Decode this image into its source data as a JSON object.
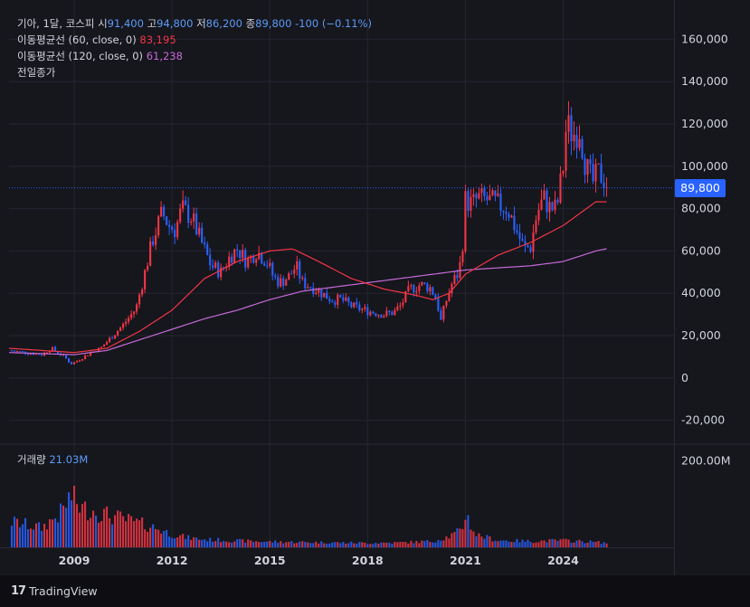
{
  "legend": {
    "symbol": "기아, 1달, 코스피",
    "open_label": "시",
    "open": "91,400",
    "high_label": "고",
    "high": "94,800",
    "low_label": "저",
    "low": "86,200",
    "close_label": "종",
    "close": "89,800",
    "change": "-100 (−0.11%)",
    "ma60_label": "이동평균선 (60, close, 0)",
    "ma60_value": "83,195",
    "ma120_label": "이동평균선 (120, close, 0)",
    "ma120_value": "61,238",
    "prev_close_label": "전일종가"
  },
  "volume_legend": {
    "label": "거래량",
    "value": "21.03M"
  },
  "price_badge": "89,800",
  "logo_text": "TradingView",
  "colors": {
    "up": "#f23645",
    "down": "#2962ff",
    "ma60": "#f23645",
    "ma120": "#c56ad6",
    "grid": "#252530",
    "axis_text": "#d1d4dc"
  },
  "chart_data": {
    "type": "candlestick",
    "interval": "1 month",
    "price_axis": {
      "ticks": [
        160000,
        140000,
        120000,
        100000,
        80000,
        60000,
        40000,
        20000,
        0,
        -20000
      ],
      "tick_labels": [
        "160,000",
        "140,000",
        "120,000",
        "100,000",
        "80,000",
        "60,000",
        "40,000",
        "20,000",
        "0",
        "-20,000"
      ],
      "range": [
        -30000,
        170000
      ]
    },
    "volume_axis": {
      "ticks": [
        200000000
      ],
      "tick_labels": [
        "200.00M"
      ]
    },
    "x_axis": {
      "tick_labels": [
        "2009",
        "2012",
        "2015",
        "2018",
        "2021",
        "2024"
      ],
      "tick_years": [
        2009,
        2012,
        2015,
        2018,
        2021,
        2024
      ]
    },
    "last_close": 89800,
    "price_path": [
      [
        2007.0,
        13000
      ],
      [
        2007.5,
        12000
      ],
      [
        2008.0,
        11000
      ],
      [
        2008.3,
        14000
      ],
      [
        2008.7,
        10000
      ],
      [
        2008.9,
        6500
      ],
      [
        2009.2,
        9000
      ],
      [
        2009.5,
        12000
      ],
      [
        2009.8,
        14000
      ],
      [
        2010.0,
        17000
      ],
      [
        2010.5,
        25000
      ],
      [
        2010.9,
        33000
      ],
      [
        2011.2,
        52000
      ],
      [
        2011.4,
        65000
      ],
      [
        2011.7,
        78000
      ],
      [
        2011.9,
        72000
      ],
      [
        2012.1,
        70000
      ],
      [
        2012.3,
        80000
      ],
      [
        2012.6,
        76000
      ],
      [
        2012.9,
        64000
      ],
      [
        2013.2,
        53000
      ],
      [
        2013.5,
        50000
      ],
      [
        2013.8,
        58000
      ],
      [
        2014.0,
        61000
      ],
      [
        2014.3,
        55000
      ],
      [
        2014.6,
        60000
      ],
      [
        2014.9,
        55000
      ],
      [
        2015.1,
        48000
      ],
      [
        2015.3,
        45000
      ],
      [
        2015.6,
        48000
      ],
      [
        2015.8,
        53000
      ],
      [
        2016.0,
        45000
      ],
      [
        2016.3,
        43000
      ],
      [
        2016.6,
        40000
      ],
      [
        2016.9,
        37000
      ],
      [
        2017.2,
        37000
      ],
      [
        2017.5,
        34000
      ],
      [
        2017.9,
        32000
      ],
      [
        2018.2,
        31000
      ],
      [
        2018.5,
        30000
      ],
      [
        2018.8,
        31000
      ],
      [
        2019.0,
        34000
      ],
      [
        2019.3,
        42000
      ],
      [
        2019.6,
        44000
      ],
      [
        2019.9,
        43000
      ],
      [
        2020.1,
        38000
      ],
      [
        2020.25,
        27000
      ],
      [
        2020.4,
        36000
      ],
      [
        2020.6,
        45000
      ],
      [
        2020.8,
        50000
      ],
      [
        2020.9,
        60000
      ],
      [
        2021.0,
        84000
      ],
      [
        2021.2,
        82000
      ],
      [
        2021.4,
        85000
      ],
      [
        2021.7,
        84000
      ],
      [
        2022.0,
        82000
      ],
      [
        2022.3,
        80000
      ],
      [
        2022.5,
        72000
      ],
      [
        2022.8,
        61000
      ],
      [
        2023.0,
        62000
      ],
      [
        2023.2,
        78000
      ],
      [
        2023.4,
        85000
      ],
      [
        2023.6,
        80000
      ],
      [
        2023.8,
        80000
      ],
      [
        2024.0,
        100000
      ],
      [
        2024.1,
        120000
      ],
      [
        2024.3,
        115000
      ],
      [
        2024.5,
        118000
      ],
      [
        2024.7,
        100000
      ],
      [
        2024.9,
        92000
      ],
      [
        2025.1,
        97000
      ],
      [
        2025.3,
        93000
      ],
      [
        2025.4,
        89800
      ]
    ],
    "ma60_path": [
      [
        2007.0,
        14000
      ],
      [
        2009.0,
        12000
      ],
      [
        2010.0,
        14000
      ],
      [
        2011.0,
        22000
      ],
      [
        2012.0,
        32000
      ],
      [
        2013.0,
        47000
      ],
      [
        2014.0,
        55000
      ],
      [
        2015.0,
        60000
      ],
      [
        2015.7,
        61000
      ],
      [
        2016.5,
        55000
      ],
      [
        2017.5,
        47000
      ],
      [
        2018.5,
        42000
      ],
      [
        2019.5,
        39000
      ],
      [
        2020.0,
        37000
      ],
      [
        2020.5,
        40000
      ],
      [
        2021.0,
        49000
      ],
      [
        2022.0,
        58000
      ],
      [
        2023.0,
        64000
      ],
      [
        2024.0,
        72000
      ],
      [
        2025.0,
        83195
      ],
      [
        2025.4,
        83195
      ]
    ],
    "ma120_path": [
      [
        2007.0,
        12000
      ],
      [
        2009.0,
        11000
      ],
      [
        2010.0,
        13000
      ],
      [
        2011.0,
        18000
      ],
      [
        2012.0,
        23000
      ],
      [
        2013.0,
        28000
      ],
      [
        2014.0,
        32000
      ],
      [
        2015.0,
        37000
      ],
      [
        2016.0,
        41000
      ],
      [
        2017.0,
        43000
      ],
      [
        2018.0,
        45000
      ],
      [
        2019.0,
        47000
      ],
      [
        2020.0,
        49000
      ],
      [
        2021.0,
        51000
      ],
      [
        2022.0,
        52000
      ],
      [
        2023.0,
        53000
      ],
      [
        2024.0,
        55000
      ],
      [
        2025.0,
        60000
      ],
      [
        2025.4,
        61238
      ]
    ],
    "volume_path": [
      [
        2007.0,
        60
      ],
      [
        2008.0,
        45
      ],
      [
        2008.6,
        80
      ],
      [
        2008.9,
        120
      ],
      [
        2009.2,
        90
      ],
      [
        2009.6,
        85
      ],
      [
        2010.0,
        75
      ],
      [
        2010.5,
        65
      ],
      [
        2011.0,
        55
      ],
      [
        2011.5,
        45
      ],
      [
        2012.0,
        30
      ],
      [
        2012.5,
        22
      ],
      [
        2013.0,
        18
      ],
      [
        2014.0,
        15
      ],
      [
        2015.0,
        13
      ],
      [
        2016.0,
        12
      ],
      [
        2017.0,
        11
      ],
      [
        2018.0,
        10
      ],
      [
        2019.0,
        11
      ],
      [
        2020.0,
        14
      ],
      [
        2020.5,
        25
      ],
      [
        2020.9,
        40
      ],
      [
        2021.0,
        80
      ],
      [
        2021.3,
        30
      ],
      [
        2022.0,
        16
      ],
      [
        2023.0,
        14
      ],
      [
        2024.0,
        16
      ],
      [
        2025.0,
        12
      ],
      [
        2025.4,
        10
      ]
    ]
  }
}
